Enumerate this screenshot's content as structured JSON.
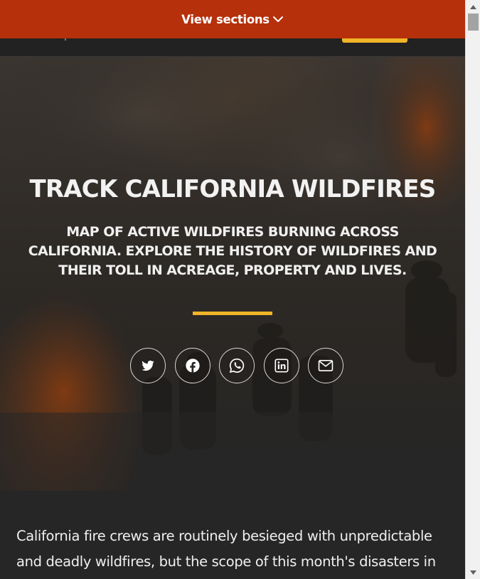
{
  "sections_bar": {
    "label": "View sections",
    "chevron_icon": "chevron-down-icon",
    "color": "#b5300b"
  },
  "hero": {
    "title": "TRACK CALIFORNIA WILDFIRES",
    "subtitle": "MAP OF ACTIVE WILDFIRES BURNING ACROSS CALIFORNIA. EXPLORE THE HISTORY OF WILDFIRES AND THEIR TOLL IN ACREAGE, PROPERTY AND LIVES.",
    "accent_color": "#f0b429"
  },
  "share": {
    "buttons": [
      {
        "name": "twitter",
        "icon": "twitter-icon"
      },
      {
        "name": "facebook",
        "icon": "facebook-icon"
      },
      {
        "name": "whatsapp",
        "icon": "whatsapp-icon"
      },
      {
        "name": "linkedin",
        "icon": "linkedin-icon"
      },
      {
        "name": "email",
        "icon": "mail-icon"
      }
    ]
  },
  "article": {
    "paragraph": "California fire crews are routinely besieged with unpredictable and deadly wildfires, but the scope of this month's disasters in"
  },
  "colors": {
    "background": "#262626",
    "text": "#f0f0f0"
  }
}
